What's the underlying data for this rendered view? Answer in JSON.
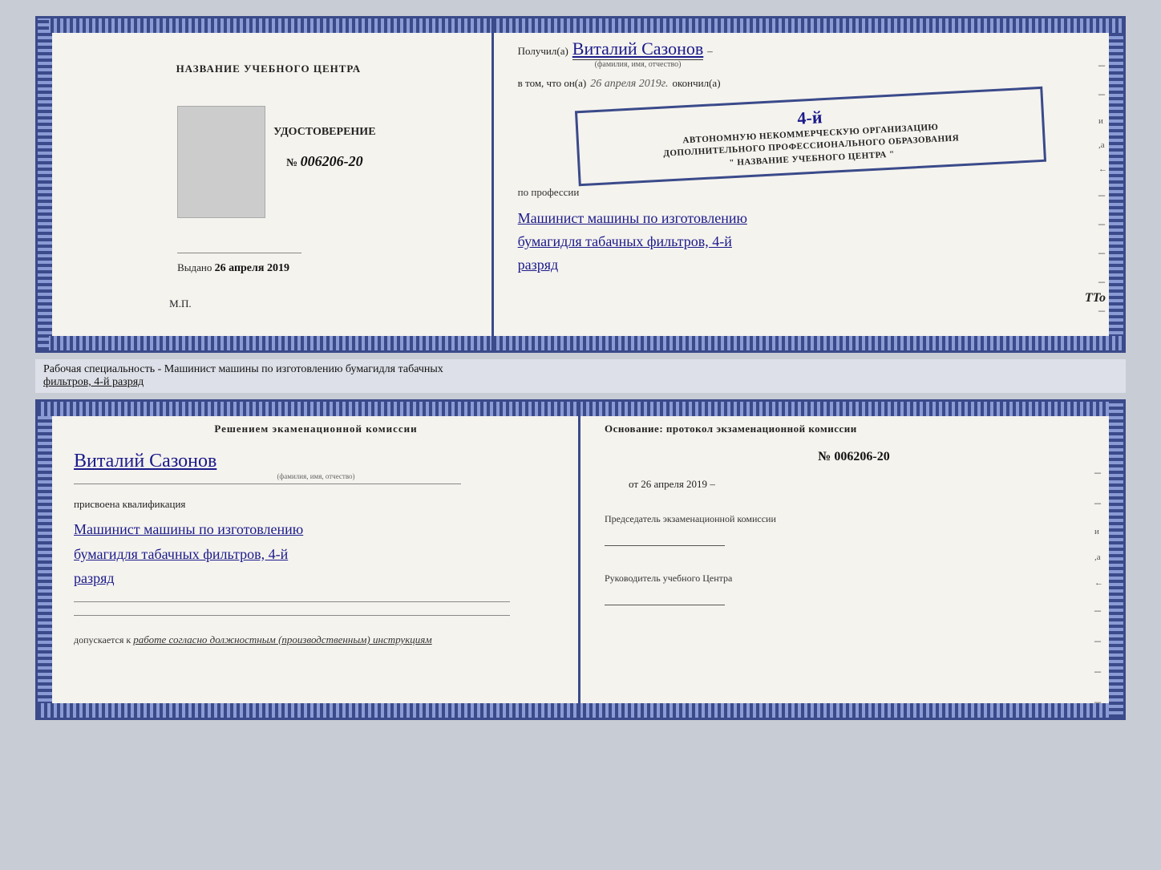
{
  "top_certificate": {
    "left": {
      "title": "НАЗВАНИЕ УЧЕБНОГО ЦЕНТРА",
      "udostoverenie": "УДОСТОВЕРЕНИЕ",
      "number_label": "№",
      "number_value": "006206-20",
      "issued_label": "Выдано",
      "issued_date": "26 апреля 2019",
      "mp": "М.П."
    },
    "right": {
      "received_label": "Получил(а)",
      "recipient_name": "Виталий Сазонов",
      "fio_label": "(фамилия, имя, отчество)",
      "date_prefix": "в том, что он(а)",
      "date_handwritten": "26 апреля 2019г.",
      "finished_label": "окончил(а)",
      "stamp_line1": "АВТОНОМНУЮ НЕКОММЕРЧЕСКУЮ ОРГАНИЗАЦИЮ",
      "stamp_line2": "ДОПОЛНИТЕЛЬНОГО ПРОФЕССИОНАЛЬНОГО ОБРАЗОВАНИЯ",
      "stamp_line3": "\" НАЗВАНИЕ УЧЕБНОГО ЦЕНТРА \"",
      "stamp_highlight": "4-й",
      "profession_label": "по профессии",
      "profession_line1": "Машинист машины по изготовлению",
      "profession_line2": "бумагидля табачных фильтров, 4-й",
      "profession_line3": "разряд"
    }
  },
  "specialty_text": {
    "prefix": "Рабочая специальность - Машинист машины по изготовлению бумагидля табачных",
    "underlined": "фильтров, 4-й разряд"
  },
  "bottom_certificate": {
    "left": {
      "commission_title": "Решением экаменационной комиссии",
      "person_name": "Виталий Сазонов",
      "fio_label": "(фамилия, имя, отчество)",
      "assigned_label": "присвоена квалификация",
      "profession_line1": "Машинист машины по изготовлению",
      "profession_line2": "бумагидля табачных фильтров, 4-й",
      "profession_line3": "разряд",
      "admitted_label": "допускается к",
      "admitted_text": "работе согласно должностным (производственным) инструкциям"
    },
    "right": {
      "foundation_label": "Основание: протокол экзаменационной комиссии",
      "protocol_number": "№ 006206-20",
      "date_prefix": "от",
      "date_value": "26 апреля 2019",
      "chairman_label": "Председатель экзаменационной комиссии",
      "head_label": "Руководитель учебного Центра"
    }
  },
  "tto_mark": "TTo"
}
